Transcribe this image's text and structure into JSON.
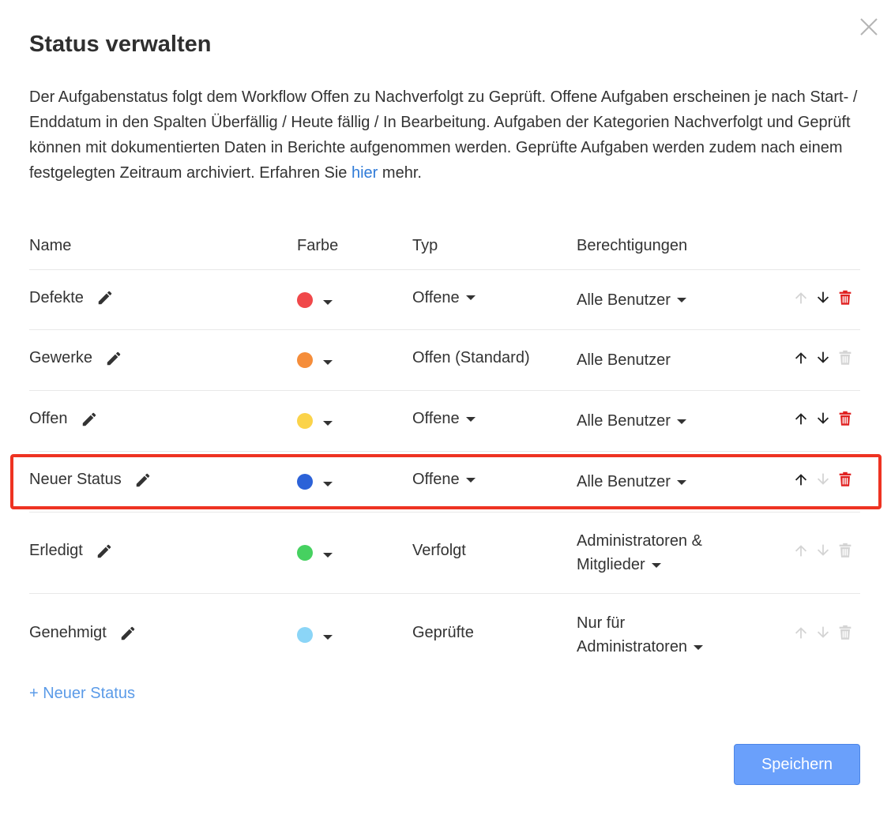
{
  "dialog": {
    "title": "Status verwalten",
    "description_text": "Der Aufgabenstatus folgt dem Workflow Offen zu Nachverfolgt zu Geprüft. Offene Aufgaben erscheinen je nach Start- / Enddatum in den Spalten Überfällig / Heute fällig / In Bearbeitung. Aufgaben der Kategorien Nachverfolgt und Geprüft können mit dokumentierten Daten in Berichte aufgenommen werden. Geprüfte Aufgaben werden zudem nach einem festgelegten Zeitraum archiviert. Erfahren Sie",
    "description_link": "hier",
    "description_tail": "mehr."
  },
  "table": {
    "headers": {
      "name": "Name",
      "color": "Farbe",
      "type": "Typ",
      "permissions": "Berechtigungen"
    },
    "rows": [
      {
        "name": "Defekte",
        "color": "#f0484a",
        "type": "Offene",
        "type_dropdown": true,
        "permissions": "Alle Benutzer",
        "perm_dropdown": true,
        "up_enabled": false,
        "down_enabled": true,
        "delete_enabled": true
      },
      {
        "name": "Gewerke",
        "color": "#f58d3a",
        "type": "Offen (Standard)",
        "type_dropdown": false,
        "permissions": "Alle Benutzer",
        "perm_dropdown": false,
        "up_enabled": true,
        "down_enabled": true,
        "delete_enabled": false
      },
      {
        "name": "Offen",
        "color": "#fbd34a",
        "type": "Offene",
        "type_dropdown": true,
        "permissions": "Alle Benutzer",
        "perm_dropdown": true,
        "up_enabled": true,
        "down_enabled": true,
        "delete_enabled": true
      },
      {
        "name": "Neuer Status",
        "color": "#2c62d8",
        "type": "Offene",
        "type_dropdown": true,
        "permissions": "Alle Benutzer",
        "perm_dropdown": true,
        "up_enabled": true,
        "down_enabled": false,
        "delete_enabled": true,
        "highlighted": true
      },
      {
        "name": "Erledigt",
        "color": "#46d160",
        "type": "Verfolgt",
        "type_dropdown": false,
        "permissions": "Administratoren & Mitglieder",
        "perm_dropdown": true,
        "up_enabled": false,
        "down_enabled": false,
        "delete_enabled": false
      },
      {
        "name": "Genehmigt",
        "color": "#8bd5f7",
        "type": "Geprüfte",
        "type_dropdown": false,
        "permissions": "Nur für Administratoren",
        "perm_dropdown": true,
        "up_enabled": false,
        "down_enabled": false,
        "delete_enabled": false
      }
    ]
  },
  "add_status_label": "+ Neuer Status",
  "save_label": "Speichern",
  "icons": {
    "close": "close-icon",
    "edit": "pencil-icon",
    "up": "arrow-up-icon",
    "down": "arrow-down-icon",
    "delete": "trash-icon"
  },
  "colors": {
    "accent": "#6aa0fb",
    "link": "#2f7bd8",
    "delete": "#e02020",
    "disabled": "#d4d4d4",
    "highlight_border": "#ee3322"
  }
}
